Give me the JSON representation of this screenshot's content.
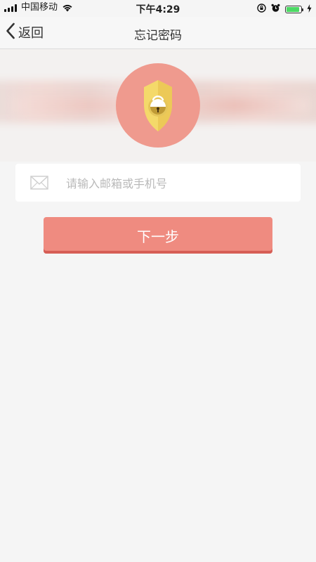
{
  "status_bar": {
    "carrier": "中国移动",
    "time": "下午4:29",
    "battery_level": 0.92
  },
  "nav": {
    "back_label": "返回",
    "title": "忘记密码"
  },
  "form": {
    "account_placeholder": "请输入邮箱或手机号",
    "account_value": ""
  },
  "actions": {
    "next_label": "下一步"
  },
  "colors": {
    "accent": "#ef8b80",
    "accent_dark": "#d65e56",
    "shield_circle": "#ef9a8e",
    "shield_yellow": "#f4d96a",
    "battery_green": "#4cd964"
  },
  "icons": {
    "status": [
      "signal-icon",
      "wifi-icon",
      "orientation-lock-icon",
      "alarm-icon",
      "battery-icon",
      "charging-icon"
    ],
    "banner": "shield-lock-icon",
    "input": "mail-icon"
  }
}
